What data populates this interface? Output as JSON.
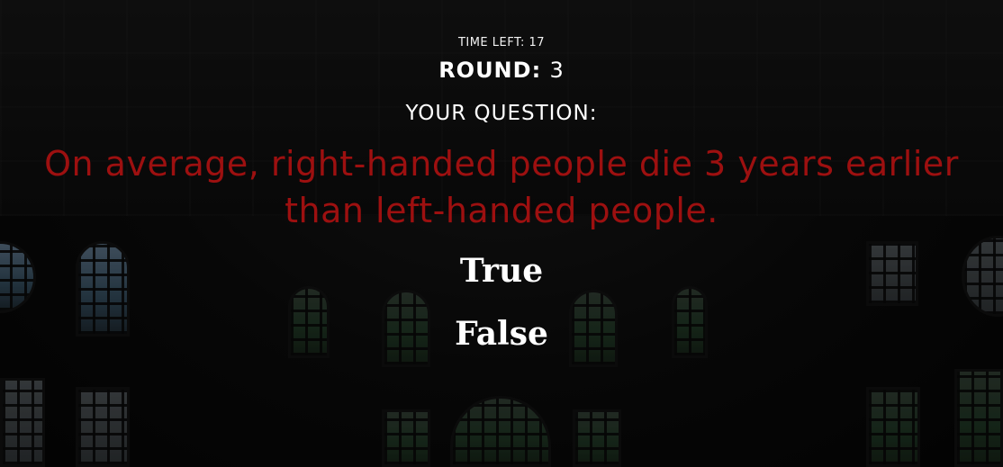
{
  "hud": {
    "time_left_label": "TIME LEFT:",
    "time_left_value": "17",
    "round_label": "ROUND:",
    "round_value": "3",
    "question_heading": "YOUR QUESTION:"
  },
  "question": {
    "text": "On average, right-handed people die 3 years earlier than left-handed people."
  },
  "answers": {
    "true_label": "True",
    "false_label": "False"
  },
  "colors": {
    "question_text": "#9d1010",
    "hud_text": "#ffffff",
    "background": "#0a0a0a"
  }
}
